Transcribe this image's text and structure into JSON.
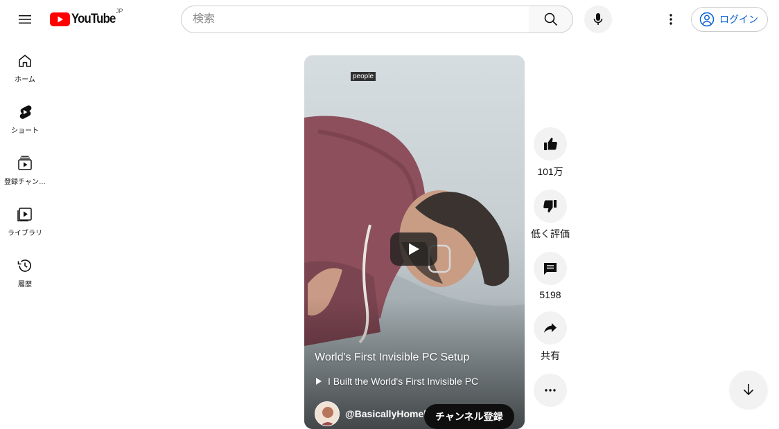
{
  "header": {
    "logo_text": "YouTube",
    "country_code": "JP",
    "search_placeholder": "検索",
    "signin_label": "ログイン",
    "icons": [
      "menu-icon",
      "search-icon",
      "mic-icon",
      "more-vert-icon",
      "account-icon"
    ]
  },
  "sidebar": {
    "items": [
      {
        "label": "ホーム",
        "icon": "home-icon"
      },
      {
        "label": "ショート",
        "icon": "shorts-icon"
      },
      {
        "label": "登録チャン…",
        "icon": "subscriptions-icon"
      },
      {
        "label": "ライブラリ",
        "icon": "library-icon"
      },
      {
        "label": "履歴",
        "icon": "history-icon"
      }
    ]
  },
  "short": {
    "tag": "people",
    "title": "World's First Invisible PC Setup",
    "related_video": "I Built the World's First Invisible PC",
    "channel": "@BasicallyHomel",
    "subscribe_label": "チャンネル登録"
  },
  "actions": {
    "like_count": "101万",
    "dislike_label": "低く評価",
    "comment_count": "5198",
    "share_label": "共有"
  },
  "colors": {
    "brand_red": "#ff0000",
    "link_blue": "#065fd4",
    "button_gray": "#f2f2f2"
  }
}
